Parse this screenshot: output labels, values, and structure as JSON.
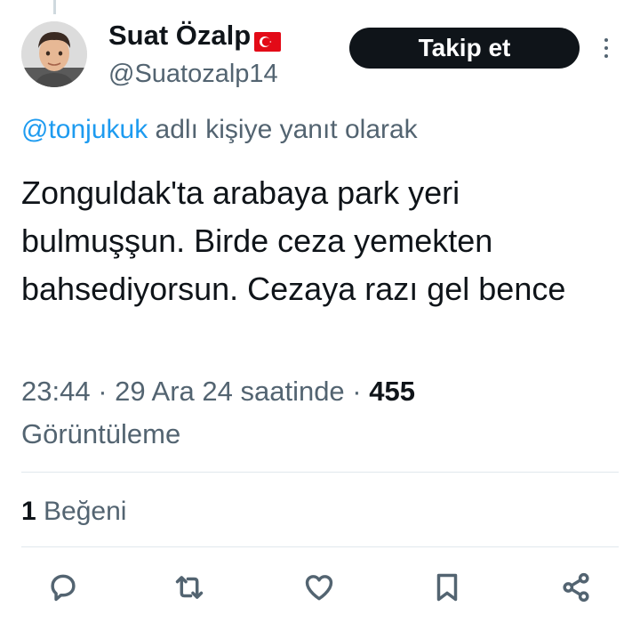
{
  "author": {
    "display_name": "Suat Özalp",
    "flag_icon": "turkey-flag-icon",
    "handle": "@Suatozalp14"
  },
  "follow_button": {
    "label": "Takip et"
  },
  "more_menu": {
    "icon": "more-vertical-icon"
  },
  "reply_context": {
    "mention": "@tonjukuk",
    "suffix": " adlı kişiye yanıt olarak"
  },
  "tweet": {
    "text": "Zonguldak'ta arabaya park yeri bulmuşşun. Birde ceza yemekten bahsediyorsun. Cezaya razı gel bence",
    "time": "23:44",
    "separator": " · ",
    "date": "29 Ara 24 saatinde",
    "views_count": "455",
    "views_label": "Görüntüleme"
  },
  "engagement": {
    "likes_count": "1",
    "likes_label": "Beğeni"
  },
  "actions": [
    {
      "name": "reply",
      "icon": "reply-icon"
    },
    {
      "name": "retweet",
      "icon": "retweet-icon"
    },
    {
      "name": "like",
      "icon": "heart-icon"
    },
    {
      "name": "bookmark",
      "icon": "bookmark-icon"
    },
    {
      "name": "share",
      "icon": "share-icon"
    }
  ],
  "colors": {
    "text_primary": "#0f1419",
    "text_secondary": "#536471",
    "link": "#1d9bf0",
    "button_bg": "#0f1419",
    "divider": "#e1e8ed",
    "flag_red": "#e30a17"
  }
}
